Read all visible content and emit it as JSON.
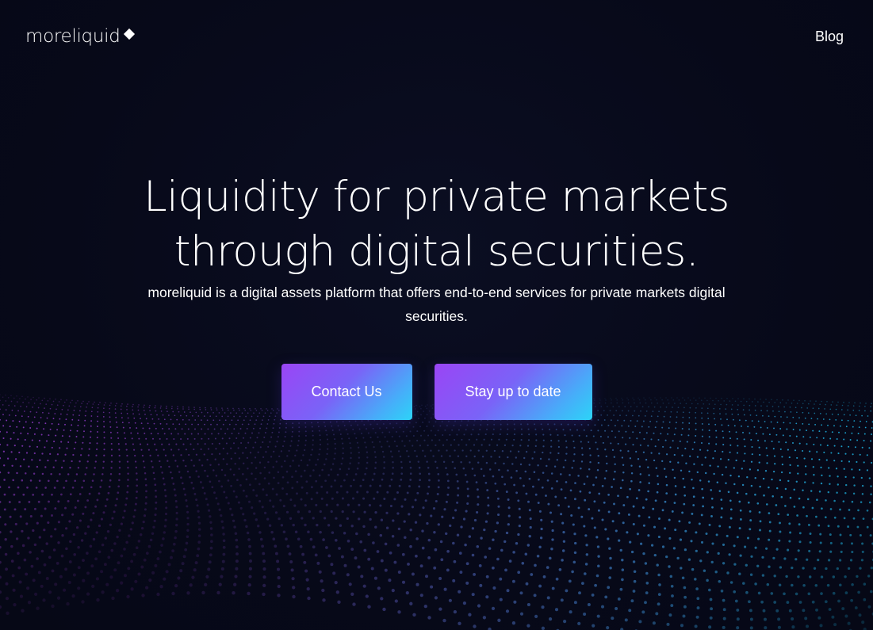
{
  "header": {
    "logo_text": "moreliquid",
    "nav": {
      "blog_label": "Blog"
    }
  },
  "hero": {
    "title_line1": "Liquidity for private markets",
    "title_line2": "through digital securities.",
    "subtitle": "moreliquid is a digital assets platform that offers end-to-end services for private markets digital securities."
  },
  "actions": {
    "contact_label": "Contact Us",
    "stay_label": "Stay up to date"
  },
  "colors": {
    "background": "#070919",
    "gradient_start": "#9a45f5",
    "gradient_end": "#2cd4f7",
    "dot_purple": "#9b3fd6",
    "dot_cyan": "#1fb8e8"
  },
  "icons": {
    "logo_mark": "diamond-icon"
  }
}
